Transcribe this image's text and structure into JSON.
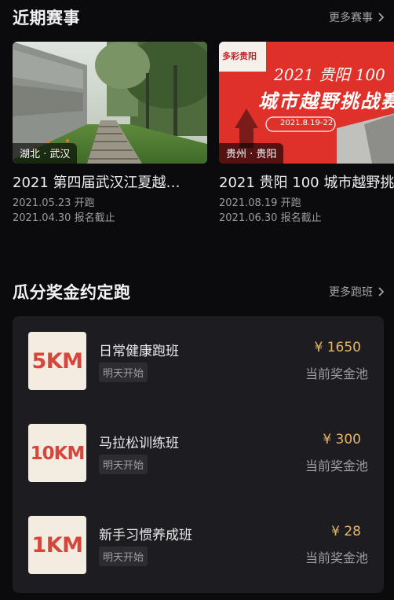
{
  "races_section": {
    "title": "近期赛事",
    "more_label": "更多赛事",
    "items": [
      {
        "location": "湖北 · 武汉",
        "title": "2021 第四届武汉江夏越…",
        "start_line": "2021.05.23 开跑",
        "deadline_line": "2021.04.30 报名截止"
      },
      {
        "location": "贵州 · 贵阳",
        "title": "2021 贵阳 100 城市越野挑",
        "start_line": "2021.08.19 开跑",
        "deadline_line": "2021.06.30 报名截止",
        "poster": {
          "headline": "2021 贵阳 100",
          "subline": "城市越野挑战赛",
          "date": "2021.8.19-22",
          "corner_text": "多彩贵阳"
        }
      }
    ]
  },
  "plans_section": {
    "title": "瓜分奖金约定跑",
    "more_label": "更多跑班",
    "items": [
      {
        "distance": "5KM",
        "name": "日常健康跑班",
        "start": "明天开始",
        "amount": "¥ 1650",
        "pool_label": "当前奖金池"
      },
      {
        "distance": "10KM",
        "name": "马拉松训练班",
        "start": "明天开始",
        "amount": "¥ 300",
        "pool_label": "当前奖金池"
      },
      {
        "distance": "1KM",
        "name": "新手习惯养成班",
        "start": "明天开始",
        "amount": "¥ 28",
        "pool_label": "当前奖金池"
      }
    ]
  },
  "icons": {
    "more_arrow": "chevron-right-icon"
  },
  "colors": {
    "accent_amount": "#e9b46a",
    "badge_text": "#d6463c",
    "background": "#0b0b0d",
    "panel": "#1d1d21"
  }
}
